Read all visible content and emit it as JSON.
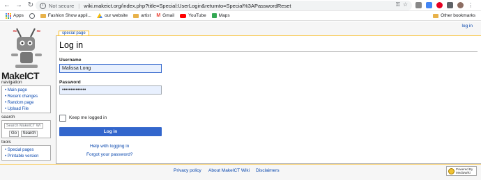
{
  "browser": {
    "security_label": "Not secure",
    "url": "wiki.makeict.org/index.php?title=Special:UserLogin&returnto=Special%3APasswordReset",
    "bookmarks": [
      "Apps",
      "Fashion Show appli...",
      "our website",
      "artist",
      "Gmail",
      "YouTube",
      "Maps"
    ],
    "other_bookmarks": "Other bookmarks"
  },
  "site": {
    "logo_text": "MakeICT",
    "login_link": "log in",
    "tab_label": "special page"
  },
  "sidebar": {
    "navigation_title": "navigation",
    "navigation_items": [
      "Main page",
      "Recent changes",
      "Random page",
      "Upload File"
    ],
    "search_title": "search",
    "search_placeholder": "Search MakeICT Wi",
    "go_label": "Go",
    "search_label": "Search",
    "tools_title": "tools",
    "tools_items": [
      "Special pages",
      "Printable version"
    ]
  },
  "form": {
    "heading": "Log in",
    "username_label": "Username",
    "username_value": "Malissa Long",
    "password_label": "Password",
    "password_value": "••••••••••••••",
    "remember_label": "Keep me logged in",
    "submit_label": "Log in",
    "help_link": "Help with logging in",
    "forgot_link": "Forgot your password?"
  },
  "footer": {
    "links": [
      "Privacy policy",
      "About MakeICT Wiki",
      "Disclaimers"
    ],
    "badge_line1": "Powered By",
    "badge_line2": "MediaWiki"
  }
}
